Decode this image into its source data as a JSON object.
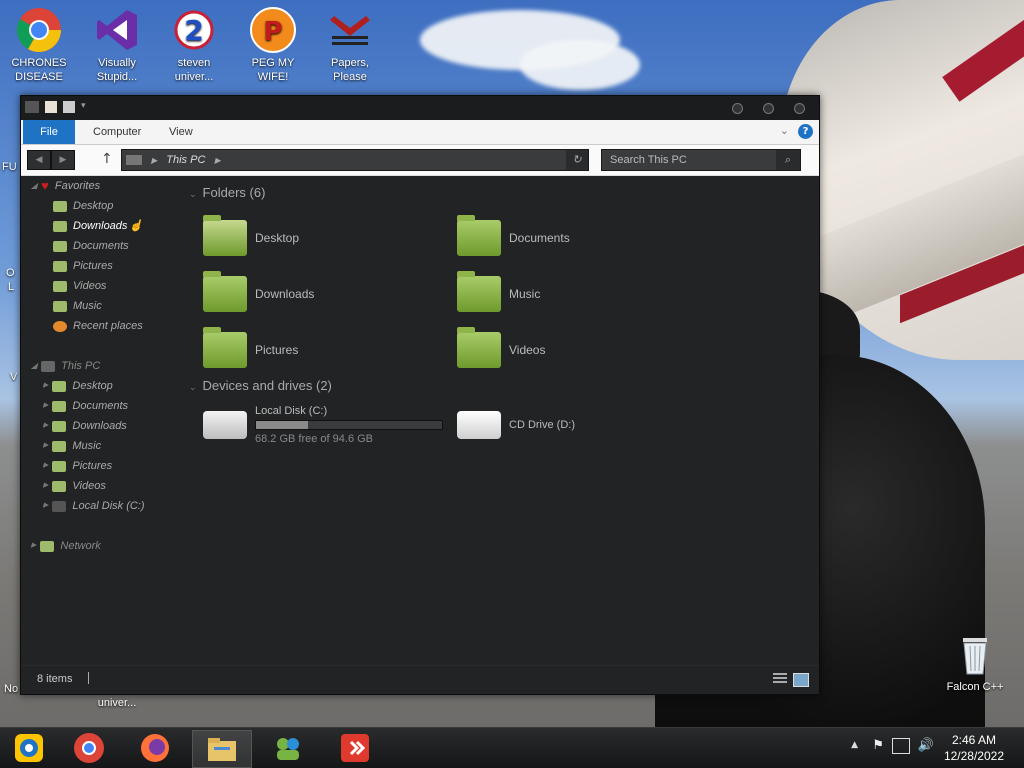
{
  "desktop": {
    "icons": [
      {
        "label_1": "CHRONES",
        "label_2": "DISEASE",
        "icon": "chrome-icon"
      },
      {
        "label_1": "Visually",
        "label_2": "Stupid...",
        "icon": "visual-studio-icon"
      },
      {
        "label_1": "steven",
        "label_2": "univer...",
        "icon": "steven-universe-icon"
      },
      {
        "label_1": "PEG MY WIFE!",
        "label_2": "",
        "icon": "peggle-icon"
      },
      {
        "label_1": "Papers,",
        "label_2": "Please",
        "icon": "papers-please-icon"
      }
    ],
    "recycle_bin": {
      "label": "Falcon C++"
    },
    "partial_labels": [
      "FU",
      "O",
      "L",
      "V",
      "No",
      "univer..."
    ]
  },
  "window": {
    "ribbon": {
      "file": "File",
      "computer": "Computer",
      "view": "View",
      "help": "?"
    },
    "address": {
      "path": "This PC"
    },
    "search": {
      "placeholder": "Search This PC"
    },
    "nav": {
      "favorites": "Favorites",
      "fav_items": [
        "Desktop",
        "Downloads",
        "Documents",
        "Pictures",
        "Videos",
        "Music",
        "Recent places"
      ],
      "thispc": "This PC",
      "pc_items": [
        "Desktop",
        "Documents",
        "Downloads",
        "Music",
        "Pictures",
        "Videos",
        "Local Disk (C:)"
      ],
      "network": "Network"
    },
    "folders_header": "Folders (6)",
    "folders": [
      "Desktop",
      "Documents",
      "Downloads",
      "Music",
      "Pictures",
      "Videos"
    ],
    "drives_header": "Devices and drives (2)",
    "drives": [
      {
        "name": "Local Disk (C:)",
        "free": "68.2 GB free of 94.6 GB",
        "used_fraction": 0.28
      },
      {
        "name": "CD Drive (D:)"
      }
    ],
    "status": {
      "items": "8 items"
    }
  },
  "taskbar": {
    "time": "2:46 AM",
    "date": "12/28/2022"
  },
  "colors": {
    "accent": "#1f73c4",
    "folder_green": "#8fb54a"
  }
}
